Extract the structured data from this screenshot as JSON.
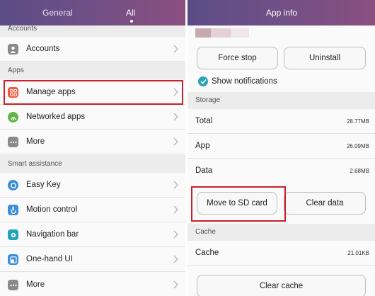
{
  "left": {
    "tabs": [
      {
        "label": "General"
      },
      {
        "label": "All"
      }
    ],
    "sections": {
      "accounts": "Accounts",
      "apps": "Apps",
      "smart": "Smart assistance"
    },
    "items": [
      {
        "label": "Accounts",
        "icon": "account-icon",
        "color": "#8a8a8a"
      },
      {
        "label": "Manage apps",
        "icon": "apps-grid-icon",
        "color": "#ef5a3c"
      },
      {
        "label": "Networked apps",
        "icon": "network-icon",
        "color": "#62b649"
      },
      {
        "label": "More",
        "icon": "more-icon",
        "color": "#8a8a8a"
      },
      {
        "label": "Easy Key",
        "icon": "easy-key-icon",
        "color": "#3a8fd8"
      },
      {
        "label": "Motion control",
        "icon": "motion-icon",
        "color": "#3a8fd8"
      },
      {
        "label": "Navigation bar",
        "icon": "navigation-icon",
        "color": "#24a4b8"
      },
      {
        "label": "One-hand UI",
        "icon": "one-hand-icon",
        "color": "#3a8fd8"
      },
      {
        "label": "More",
        "icon": "more-icon",
        "color": "#8a8a8a"
      }
    ]
  },
  "right": {
    "title": "App info",
    "buttons": {
      "force_stop": "Force stop",
      "uninstall": "Uninstall"
    },
    "show_notifications": "Show notifications",
    "storage_header": "Storage",
    "storage": [
      {
        "label": "Total",
        "value": "28.77MB"
      },
      {
        "label": "App",
        "value": "26.09MB"
      },
      {
        "label": "Data",
        "value": "2.68MB"
      }
    ],
    "storage_buttons": {
      "move": "Move to SD card",
      "clear_data": "Clear data"
    },
    "cache_header": "Cache",
    "cache": {
      "label": "Cache",
      "value": "21.01KB"
    },
    "clear_cache": "Clear cache"
  },
  "colors": {
    "highlight": "#c8202c",
    "topbar": "#6f4f86",
    "accent": "#2aa3b5"
  }
}
